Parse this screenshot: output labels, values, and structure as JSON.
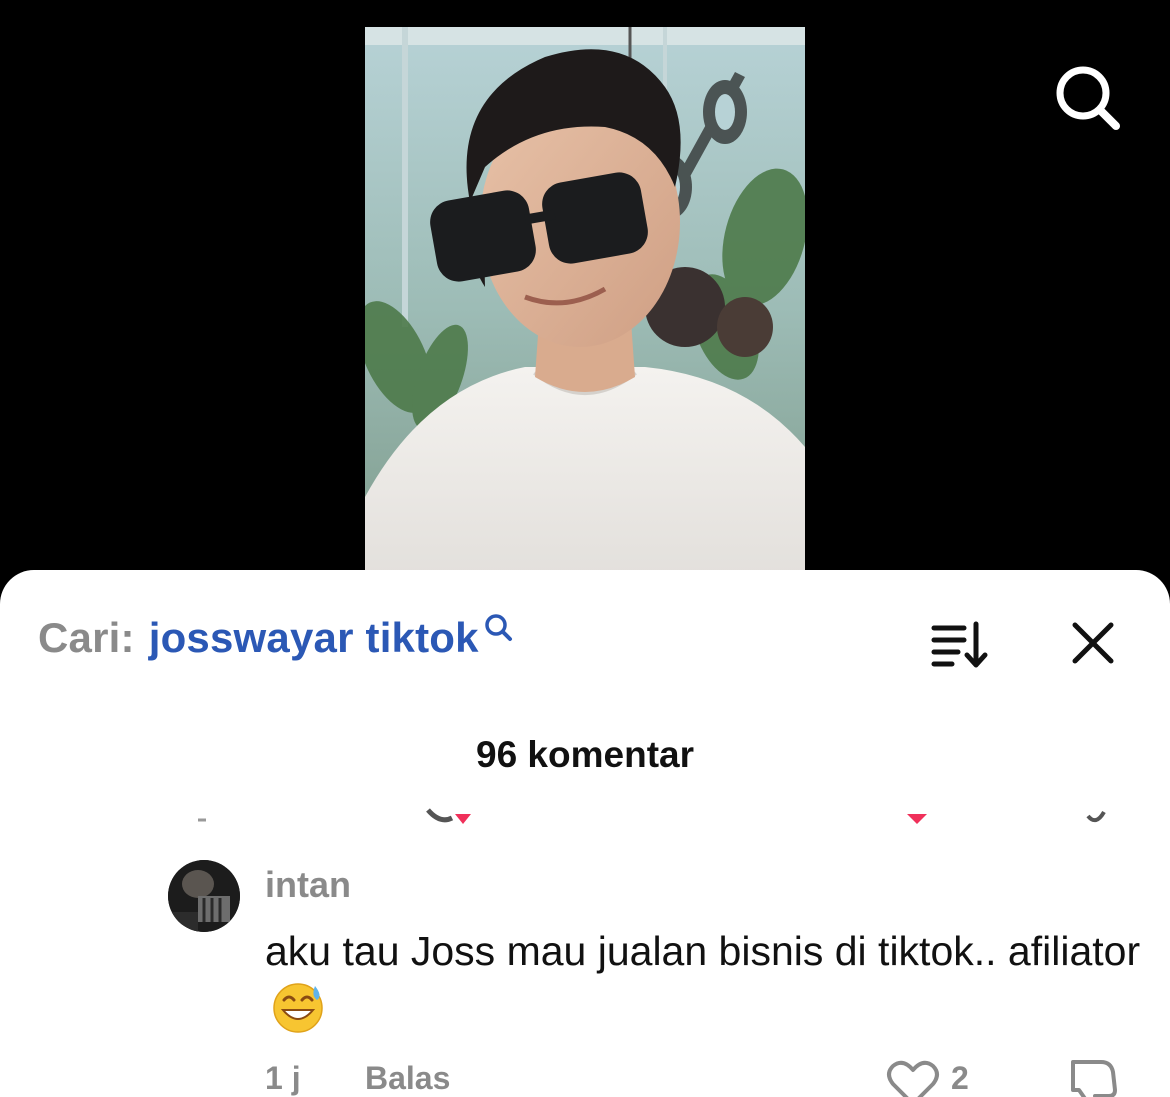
{
  "search_bar": {
    "prefix": "Cari:",
    "query": "josswayar tiktok"
  },
  "icons": {
    "top_search": "search-icon",
    "sort": "sort-icon",
    "close": "close-icon",
    "like": "heart-icon",
    "dislike": "dislike-icon"
  },
  "comments_header": {
    "count_label": "96 komentar"
  },
  "comment": {
    "username": "intan",
    "text": "aku tau Joss mau jualan bisnis di tiktok.. afiliator",
    "time": "1 j",
    "reply_label": "Balas",
    "likes": "2"
  },
  "colors": {
    "query_link": "#2b58b5",
    "muted": "#8a8a8a",
    "background": "#000000",
    "sheet": "#ffffff"
  }
}
